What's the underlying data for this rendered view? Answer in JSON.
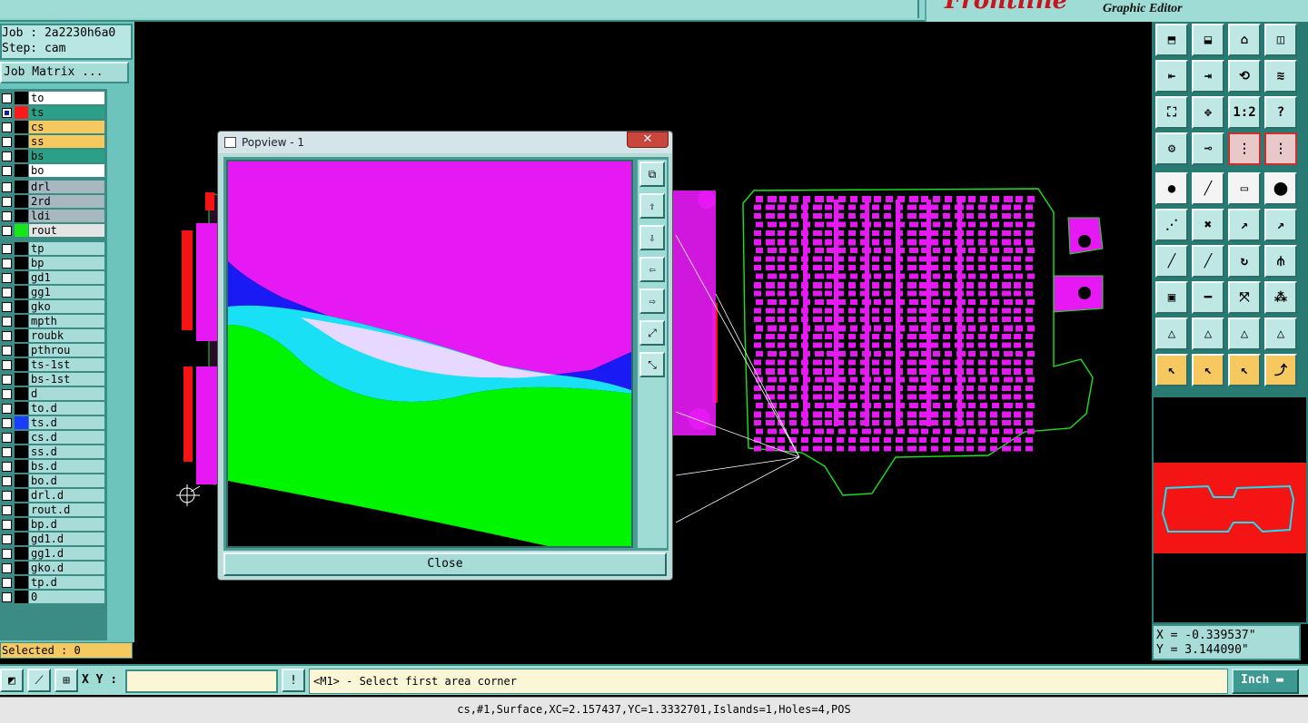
{
  "brand": {
    "logo": "Frontline",
    "subtitle": "Graphic Editor"
  },
  "job": {
    "job_line": "Job : 2a2230h6a0",
    "step_line": "Step: cam"
  },
  "job_matrix_label": "Job Matrix ...",
  "layers": [
    {
      "name": "to",
      "color": "#ffffff",
      "swatch": "#000000",
      "checked": false,
      "mark": ""
    },
    {
      "name": "ts",
      "color": "#2aa088",
      "swatch": "#ff1a1a",
      "checked": true,
      "mark": "▣"
    },
    {
      "name": "cs",
      "color": "#f5c860",
      "swatch": "#000000",
      "checked": false,
      "mark": ""
    },
    {
      "name": "ss",
      "color": "#f5c860",
      "swatch": "#000000",
      "checked": false,
      "mark": ""
    },
    {
      "name": "bs",
      "color": "#2aa088",
      "swatch": "#000000",
      "checked": false,
      "mark": ""
    },
    {
      "name": "bo",
      "color": "#ffffff",
      "swatch": "#000000",
      "checked": false,
      "mark": ""
    },
    {
      "name": "drl",
      "color": "#a8b8c0",
      "swatch": "#000000",
      "checked": false,
      "mark": ""
    },
    {
      "name": "2rd",
      "color": "#a8b8c0",
      "swatch": "#000000",
      "checked": false,
      "mark": ""
    },
    {
      "name": "ldi",
      "color": "#a8b8c0",
      "swatch": "#000000",
      "checked": false,
      "mark": ""
    },
    {
      "name": "rout",
      "color": "#e4e4e4",
      "swatch": "#19e619",
      "checked": false,
      "mark": ""
    },
    {
      "name": "tp",
      "color": "#a8dcd8",
      "swatch": "#000000",
      "checked": false,
      "mark": ""
    },
    {
      "name": "bp",
      "color": "#a8dcd8",
      "swatch": "#000000",
      "checked": false,
      "mark": ""
    },
    {
      "name": "gd1",
      "color": "#a8dcd8",
      "swatch": "#000000",
      "checked": false,
      "mark": ""
    },
    {
      "name": "gg1",
      "color": "#a8dcd8",
      "swatch": "#000000",
      "checked": false,
      "mark": ""
    },
    {
      "name": "gko",
      "color": "#a8dcd8",
      "swatch": "#000000",
      "checked": false,
      "mark": ""
    },
    {
      "name": "mpth",
      "color": "#a8dcd8",
      "swatch": "#000000",
      "checked": false,
      "mark": ""
    },
    {
      "name": "roubk",
      "color": "#a8dcd8",
      "swatch": "#000000",
      "checked": false,
      "mark": ""
    },
    {
      "name": "pthrou",
      "color": "#a8dcd8",
      "swatch": "#000000",
      "checked": false,
      "mark": ""
    },
    {
      "name": "ts-1st",
      "color": "#a8dcd8",
      "swatch": "#000000",
      "checked": false,
      "mark": ""
    },
    {
      "name": "bs-1st",
      "color": "#a8dcd8",
      "swatch": "#000000",
      "checked": false,
      "mark": ""
    },
    {
      "name": "d",
      "color": "#a8dcd8",
      "swatch": "#000000",
      "checked": false,
      "mark": ""
    },
    {
      "name": "to.d",
      "color": "#a8dcd8",
      "swatch": "#000000",
      "checked": false,
      "mark": "✎"
    },
    {
      "name": "ts.d",
      "color": "#a8dcd8",
      "swatch": "#1a3cff",
      "checked": false,
      "mark": "✎"
    },
    {
      "name": "cs.d",
      "color": "#a8dcd8",
      "swatch": "#000000",
      "checked": false,
      "mark": "✎"
    },
    {
      "name": "ss.d",
      "color": "#a8dcd8",
      "swatch": "#000000",
      "checked": false,
      "mark": "✎"
    },
    {
      "name": "bs.d",
      "color": "#a8dcd8",
      "swatch": "#000000",
      "checked": false,
      "mark": "✎"
    },
    {
      "name": "bo.d",
      "color": "#a8dcd8",
      "swatch": "#000000",
      "checked": false,
      "mark": ""
    },
    {
      "name": "drl.d",
      "color": "#a8dcd8",
      "swatch": "#000000",
      "checked": false,
      "mark": ""
    },
    {
      "name": "rout.d",
      "color": "#a8dcd8",
      "swatch": "#000000",
      "checked": false,
      "mark": ""
    },
    {
      "name": "bp.d",
      "color": "#a8dcd8",
      "swatch": "#000000",
      "checked": false,
      "mark": ""
    },
    {
      "name": "gd1.d",
      "color": "#a8dcd8",
      "swatch": "#000000",
      "checked": false,
      "mark": "✎"
    },
    {
      "name": "gg1.d",
      "color": "#a8dcd8",
      "swatch": "#000000",
      "checked": false,
      "mark": ""
    },
    {
      "name": "gko.d",
      "color": "#a8dcd8",
      "swatch": "#000000",
      "checked": false,
      "mark": "✎"
    },
    {
      "name": "tp.d",
      "color": "#a8dcd8",
      "swatch": "#000000",
      "checked": false,
      "mark": ""
    },
    {
      "name": "0",
      "color": "#a8dcd8",
      "swatch": "#000000",
      "checked": false,
      "mark": ""
    }
  ],
  "selected_label": "Selected : 0",
  "popview": {
    "title": "Popview - 1",
    "close_label": "Close"
  },
  "coords": {
    "x": "X = -0.339537\"",
    "y": "Y = 3.144090\""
  },
  "command": {
    "xy_label": "X Y :",
    "xy_value": "",
    "prompt": "<M1> - Select first area corner",
    "unit": "Inch"
  },
  "status_line": "cs,#1,Surface,XC=2.157437,YC=1.3332701,Islands=1,Holes=4,POS",
  "colors": {
    "pcb_pad": "#e619f5",
    "pcb_outline": "#19e619",
    "surface_green": "#00f500",
    "surface_cyan": "#19e0f5",
    "surface_blue": "#1a1af5",
    "surface_white": "#e6d8ff",
    "minimap_red": "#f51414",
    "accent_teal": "#3c8c86"
  }
}
